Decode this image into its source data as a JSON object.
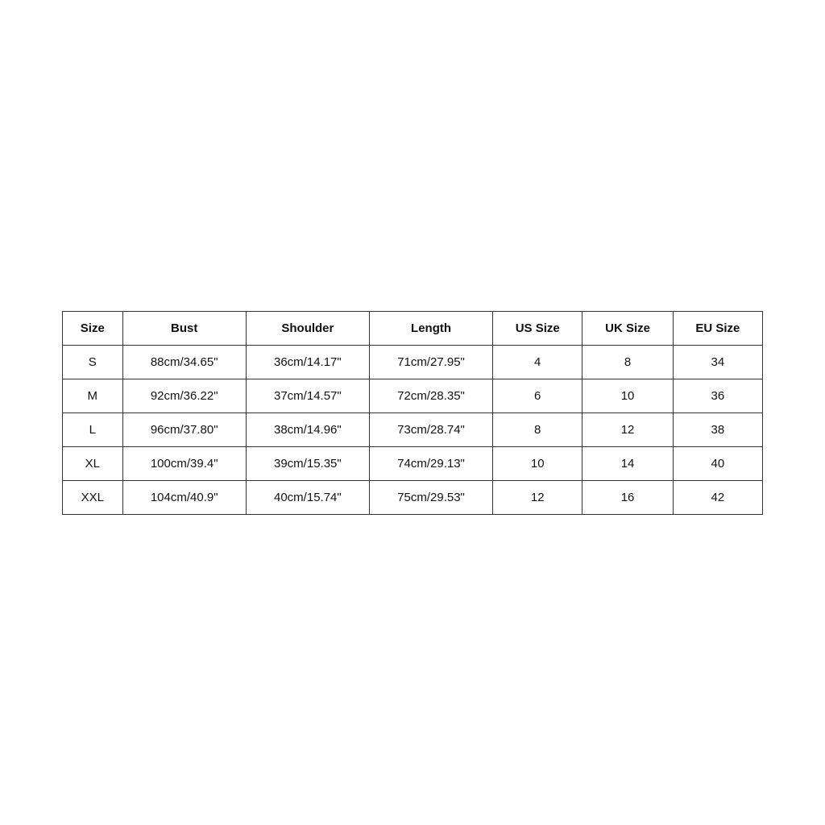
{
  "table": {
    "headers": [
      "Size",
      "Bust",
      "Shoulder",
      "Length",
      "US Size",
      "UK Size",
      "EU Size"
    ],
    "rows": [
      {
        "size": "S",
        "bust": "88cm/34.65\"",
        "shoulder": "36cm/14.17\"",
        "length": "71cm/27.95\"",
        "us_size": "4",
        "uk_size": "8",
        "eu_size": "34"
      },
      {
        "size": "M",
        "bust": "92cm/36.22\"",
        "shoulder": "37cm/14.57\"",
        "length": "72cm/28.35\"",
        "us_size": "6",
        "uk_size": "10",
        "eu_size": "36"
      },
      {
        "size": "L",
        "bust": "96cm/37.80\"",
        "shoulder": "38cm/14.96\"",
        "length": "73cm/28.74\"",
        "us_size": "8",
        "uk_size": "12",
        "eu_size": "38"
      },
      {
        "size": "XL",
        "bust": "100cm/39.4\"",
        "shoulder": "39cm/15.35\"",
        "length": "74cm/29.13\"",
        "us_size": "10",
        "uk_size": "14",
        "eu_size": "40"
      },
      {
        "size": "XXL",
        "bust": "104cm/40.9\"",
        "shoulder": "40cm/15.74\"",
        "length": "75cm/29.53\"",
        "us_size": "12",
        "uk_size": "16",
        "eu_size": "42"
      }
    ]
  }
}
